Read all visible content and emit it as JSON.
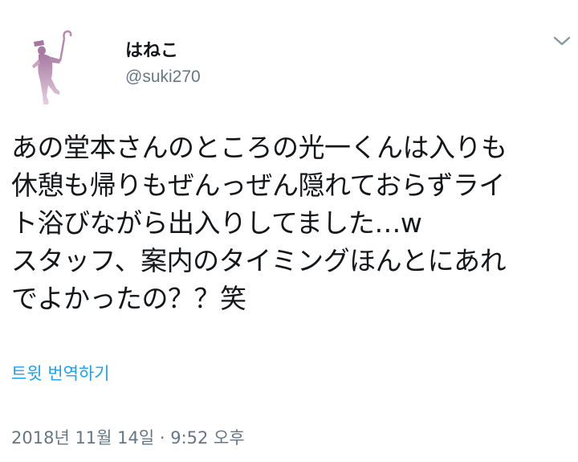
{
  "user": {
    "display_name": "はねこ",
    "handle": "@suki270"
  },
  "icons": {
    "avatar": "dancing-silhouette-avatar",
    "menu": "chevron-down-icon"
  },
  "tweet": {
    "text": "あの堂本さんのところの光一くんは入りも\n休憩も帰りもぜんっぜん隠れておらずライ\nト浴びながら出入りしてました…w\nスタッフ、案内のタイミングほんとにあれ\nでよかったの？？笑",
    "translate_label": "트윗 번역하기",
    "timestamp": "2018년 11월 14일 · 9:52 오후"
  },
  "colors": {
    "link": "#1da1f2",
    "secondary_text": "#657786",
    "primary_text": "#14171a",
    "avatar_gradient_top": "#b07fa8",
    "avatar_gradient_bottom": "#e9d0e1"
  }
}
